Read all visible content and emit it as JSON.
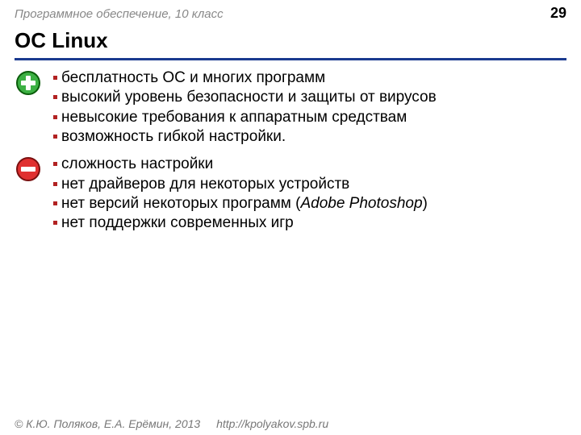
{
  "header": {
    "breadcrumb": "Программное обеспечение, 10 класс",
    "page_number": "29"
  },
  "title": "ОС Linux",
  "pros": {
    "icon": "plus-icon",
    "items": [
      "бесплатность ОС и многих программ",
      "высокий уровень безопасности и защиты от вирусов",
      "невысокие требования к аппаратным средствам",
      "возможность гибкой настройки."
    ]
  },
  "cons": {
    "icon": "minus-icon",
    "items": [
      "сложность настройки",
      "нет драйверов для некоторых устройств",
      {
        "pre": "нет версий некоторых программ (",
        "ital": "Adobe Photoshop",
        "post": ")"
      },
      "нет поддержки современных игр"
    ]
  },
  "footer": {
    "copyright": "© К.Ю. Поляков, Е.А. Ерёмин, 2013",
    "url": "http://kpolyakov.spb.ru"
  }
}
